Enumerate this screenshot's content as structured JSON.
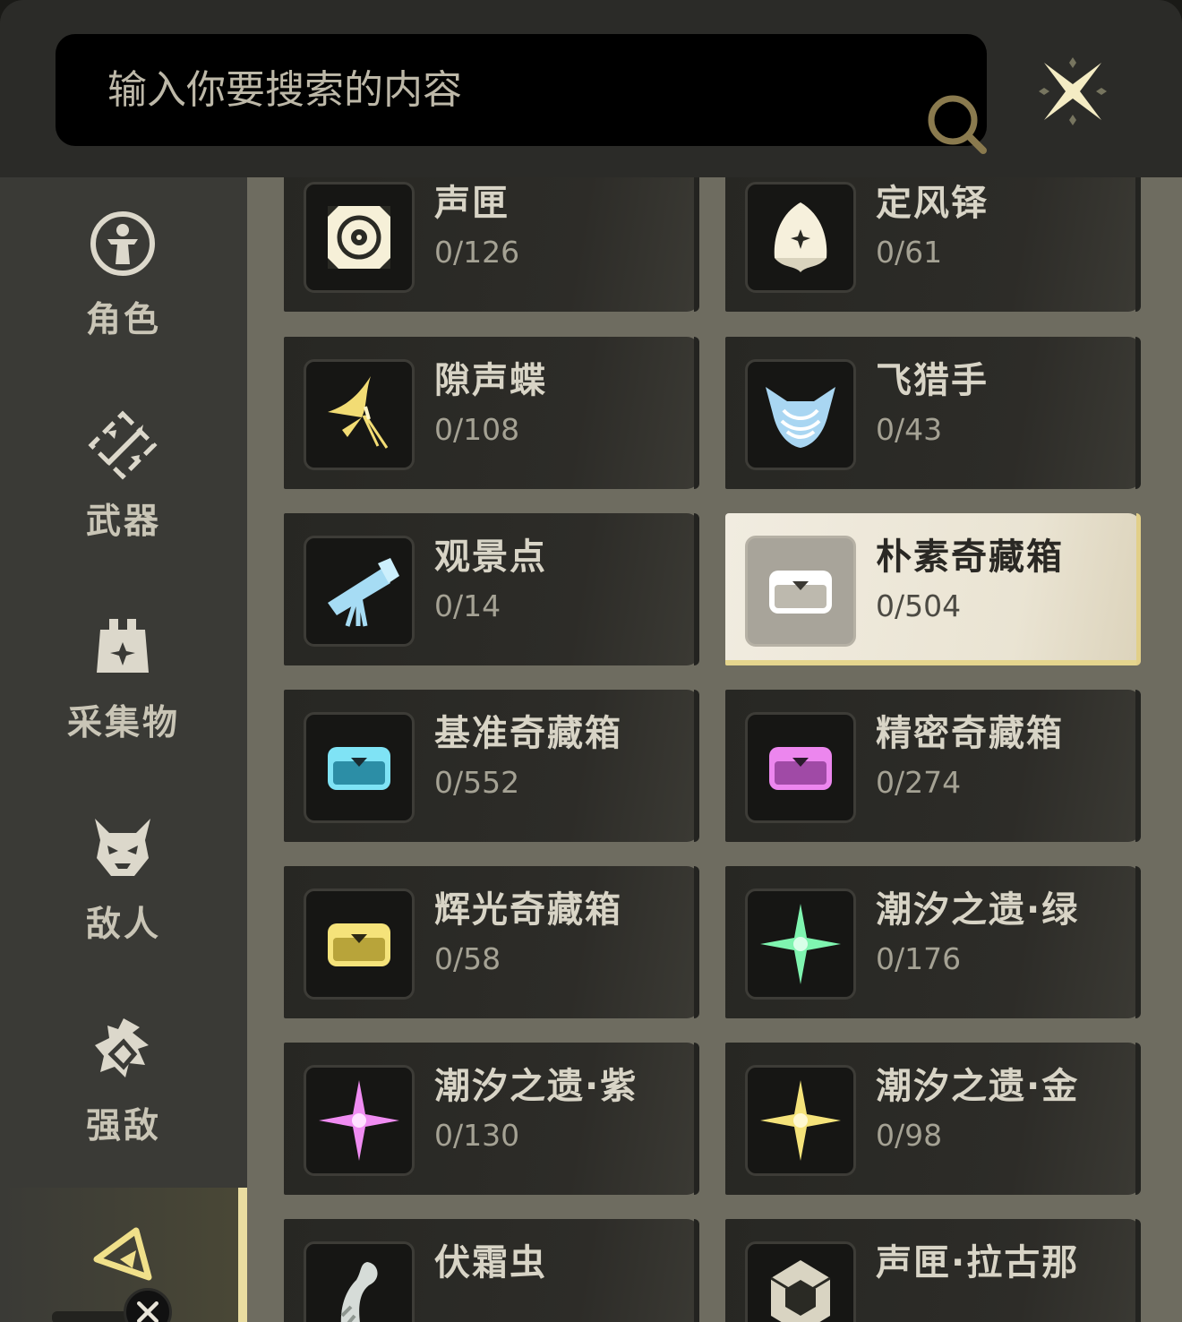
{
  "search": {
    "placeholder": "输入你要搜索的内容",
    "icon": "search-icon"
  },
  "close": {
    "icon": "close-icon"
  },
  "sidebar": {
    "items": [
      {
        "label": "角色",
        "icon": "character-icon"
      },
      {
        "label": "武器",
        "icon": "weapon-icon"
      },
      {
        "label": "采集物",
        "icon": "collectible-icon"
      },
      {
        "label": "敌人",
        "icon": "enemy-icon"
      },
      {
        "label": "强敌",
        "icon": "boss-icon"
      }
    ],
    "active_icon": "treasure-category-icon"
  },
  "items": [
    {
      "name": "声匣",
      "count": "0/126",
      "icon": "sonance-casket-icon"
    },
    {
      "name": "定风铎",
      "count": "0/61",
      "icon": "wind-bell-icon"
    },
    {
      "name": "隙声蝶",
      "count": "0/108",
      "icon": "butterfly-icon"
    },
    {
      "name": "飞猎手",
      "count": "0/43",
      "icon": "flying-hunter-icon"
    },
    {
      "name": "观景点",
      "count": "0/14",
      "icon": "telescope-icon"
    },
    {
      "name": "朴素奇藏箱",
      "count": "0/504",
      "icon": "basic-chest-icon",
      "selected": true
    },
    {
      "name": "基准奇藏箱",
      "count": "0/552",
      "icon": "standard-chest-icon"
    },
    {
      "name": "精密奇藏箱",
      "count": "0/274",
      "icon": "advanced-chest-icon"
    },
    {
      "name": "辉光奇藏箱",
      "count": "0/58",
      "icon": "premium-chest-icon"
    },
    {
      "name": "潮汐之遗·绿",
      "count": "0/176",
      "icon": "green-tidal-star-icon"
    },
    {
      "name": "潮汐之遗·紫",
      "count": "0/130",
      "icon": "purple-tidal-star-icon"
    },
    {
      "name": "潮汐之遗·金",
      "count": "0/98",
      "icon": "gold-tidal-star-icon"
    },
    {
      "name": "伏霜虫",
      "count": "",
      "icon": "frost-bug-icon"
    },
    {
      "name": "声匣·拉古那",
      "count": "",
      "icon": "lagoon-casket-icon"
    }
  ],
  "colors": {
    "chest_basic": "#ffffff",
    "chest_standard": "#7fe3f5",
    "chest_advanced": "#ec86ee",
    "chest_premium": "#f5e37a",
    "star_green": "#7ff5b0",
    "star_purple": "#f08cf2",
    "star_gold": "#f5e37a",
    "accent": "#e9dca0"
  }
}
